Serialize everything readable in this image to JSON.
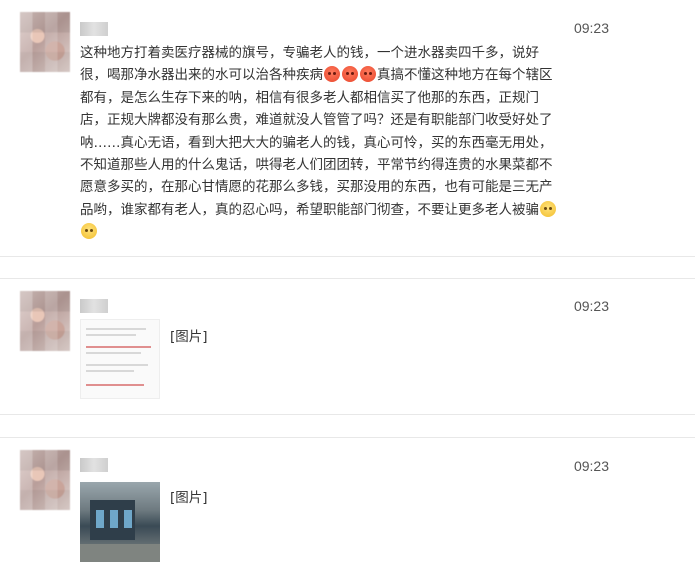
{
  "messages": [
    {
      "time": "09:23",
      "text_lines": [
        "这种地方打着卖医疗器械的旗号，专骗老人的钱，一个进水器卖四千多，说好",
        "很，喝那净水器出来的水可以治各种疾病",
        "真搞不懂这种地方在每个辖区",
        "都有，是怎么生存下来的呐，相信有很多老人都相信买了他那的东西，正规门",
        "店，正规大牌都没有那么贵，难道就没人管管了吗？还是有职能部门收受好处了",
        "呐……真心无语，看到大把大大的骗老人的钱，真心可怜，买的东西毫无用处，",
        "不知道那些人用的什么鬼话，哄得老人们团团转，平常节约得连贵的水果菜都不",
        "愿意多买的，在那心甘情愿的花那么多钱，买那没用的东西，也有可能是三无产",
        "品哟，谁家都有老人，真的忍心吗，希望职能部门彻查，不要让更多老人被骗"
      ],
      "emoji": {
        "angry": "angry-face",
        "sad": "pleading-face"
      }
    },
    {
      "time": "09:23",
      "image_label": "[图片]",
      "thumbnail": "document-screenshot"
    },
    {
      "time": "09:23",
      "image_label": "[图片]",
      "thumbnail": "storefront-photo"
    }
  ]
}
